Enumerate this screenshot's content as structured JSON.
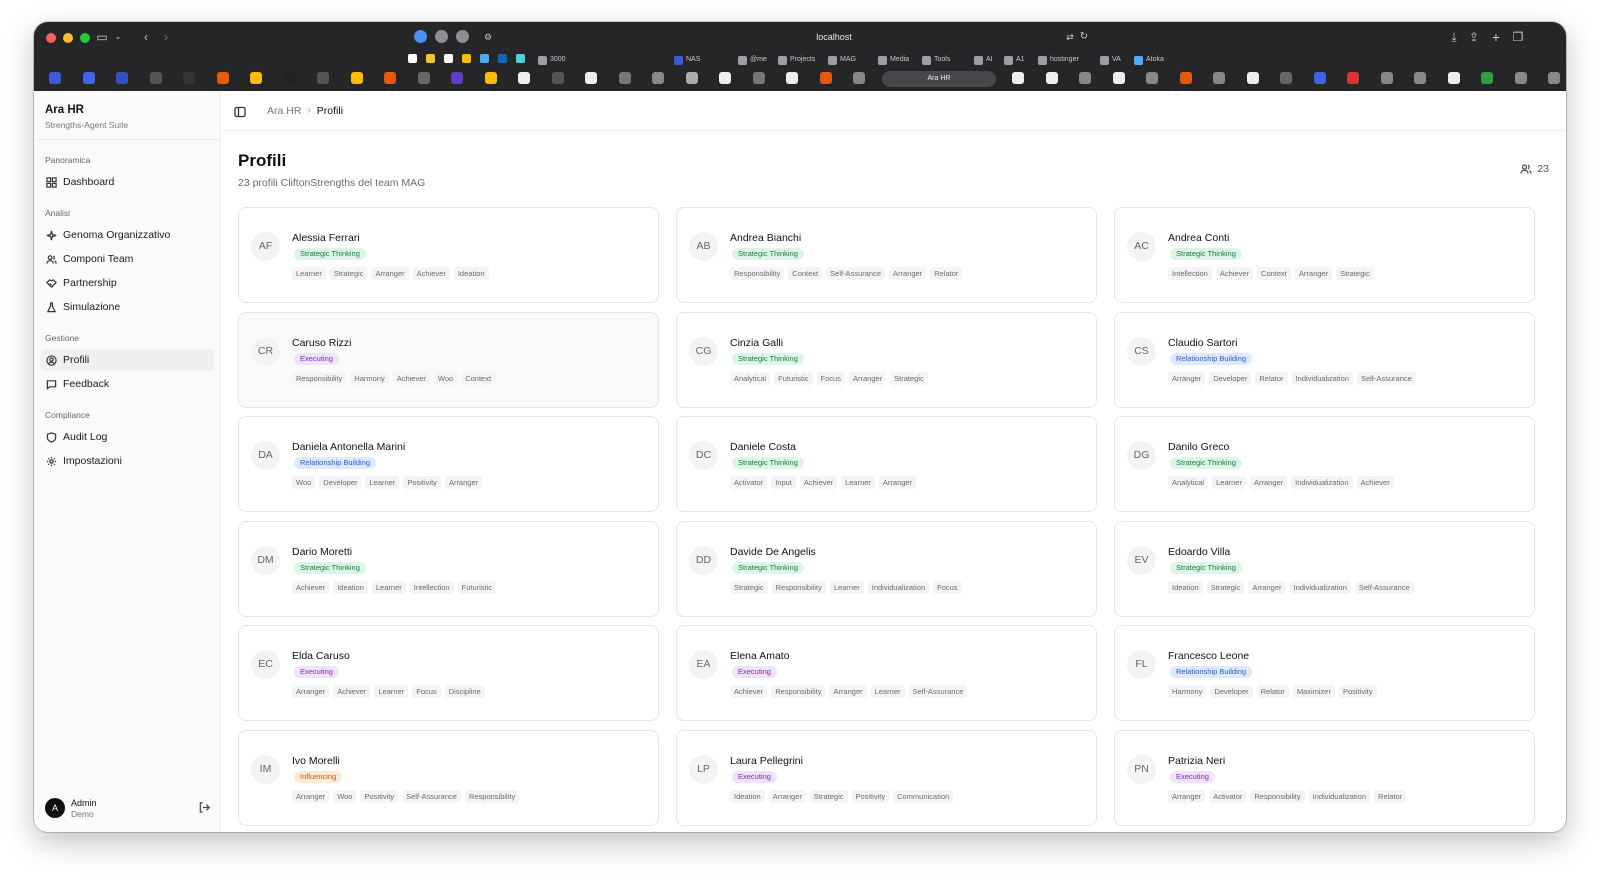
{
  "browser": {
    "url": "localhost",
    "active_tab_label": "Ara HR",
    "bookmarks": [
      {
        "label": "3000",
        "color": "#9aa0a6"
      },
      {
        "label": "NAS",
        "color": "#3b5bdb"
      },
      {
        "label": "@me",
        "color": "#9aa0a6"
      },
      {
        "label": "Projects",
        "color": "#9aa0a6"
      },
      {
        "label": "MAG",
        "color": "#9aa0a6"
      },
      {
        "label": "Media",
        "color": "#9aa0a6"
      },
      {
        "label": "Tools",
        "color": "#9aa0a6"
      },
      {
        "label": "AI",
        "color": "#9aa0a6"
      },
      {
        "label": "A1",
        "color": "#9aa0a6"
      },
      {
        "label": "hostinger",
        "color": "#9aa0a6"
      },
      {
        "label": "VA",
        "color": "#9aa0a6"
      },
      {
        "label": "Atoka",
        "color": "#4dabf7"
      }
    ]
  },
  "sidebar": {
    "brand_title": "Ara HR",
    "brand_subtitle": "Strengths-Agent Suite",
    "groups": [
      {
        "label": "Panoramica",
        "items": [
          {
            "label": "Dashboard",
            "icon": "grid-icon"
          }
        ]
      },
      {
        "label": "Analisi",
        "items": [
          {
            "label": "Genoma Organizzativo",
            "icon": "sparkle-icon"
          },
          {
            "label": "Componi Team",
            "icon": "users-icon"
          },
          {
            "label": "Partnership",
            "icon": "handshake-icon"
          },
          {
            "label": "Simulazione",
            "icon": "flask-icon"
          }
        ]
      },
      {
        "label": "Gestione",
        "items": [
          {
            "label": "Profili",
            "icon": "user-circle-icon"
          },
          {
            "label": "Feedback",
            "icon": "message-icon"
          }
        ]
      },
      {
        "label": "Compliance",
        "items": [
          {
            "label": "Audit Log",
            "icon": "shield-icon"
          },
          {
            "label": "Impostazioni",
            "icon": "gear-icon"
          }
        ]
      }
    ],
    "active_item": "Profili",
    "user": {
      "initial": "A",
      "name": "Admin",
      "role": "Demo"
    }
  },
  "header": {
    "breadcrumb": [
      "Ara HR",
      "Profili"
    ]
  },
  "page": {
    "title": "Profili",
    "subtitle": "23 profili CliftonStrengths del team MAG",
    "count": "23"
  },
  "theme_colors": {
    "Strategic Thinking": {
      "bg": "#dcf5e6",
      "fg": "#1a7a44"
    },
    "Executing": {
      "bg": "#efe2fb",
      "fg": "#7a2fb8"
    },
    "Relationship Building": {
      "bg": "#dde9ff",
      "fg": "#2e59c9"
    },
    "Influencing": {
      "bg": "#ffe8d4",
      "fg": "#c25b12"
    }
  },
  "profiles": [
    {
      "initials": "AF",
      "name": "Alessia Ferrari",
      "theme": "Strategic Thinking",
      "strengths": [
        "Learner",
        "Strategic",
        "Arranger",
        "Achiever",
        "Ideation"
      ]
    },
    {
      "initials": "AB",
      "name": "Andrea Bianchi",
      "theme": "Strategic Thinking",
      "strengths": [
        "Responsibility",
        "Context",
        "Self-Assurance",
        "Arranger",
        "Relator"
      ]
    },
    {
      "initials": "AC",
      "name": "Andrea Conti",
      "theme": "Strategic Thinking",
      "strengths": [
        "Intellection",
        "Achiever",
        "Context",
        "Arranger",
        "Strategic"
      ]
    },
    {
      "initials": "CR",
      "name": "Caruso Rizzi",
      "theme": "Executing",
      "strengths": [
        "Responsibility",
        "Harmony",
        "Achiever",
        "Woo",
        "Context"
      ]
    },
    {
      "initials": "CG",
      "name": "Cinzia Galli",
      "theme": "Strategic Thinking",
      "strengths": [
        "Analytical",
        "Futuristic",
        "Focus",
        "Arranger",
        "Strategic"
      ]
    },
    {
      "initials": "CS",
      "name": "Claudio Sartori",
      "theme": "Relationship Building",
      "strengths": [
        "Arranger",
        "Developer",
        "Relator",
        "Individualization",
        "Self-Assurance"
      ]
    },
    {
      "initials": "DA",
      "name": "Daniela Antonella Marini",
      "theme": "Relationship Building",
      "strengths": [
        "Woo",
        "Developer",
        "Learner",
        "Positivity",
        "Arranger"
      ]
    },
    {
      "initials": "DC",
      "name": "Daniele Costa",
      "theme": "Strategic Thinking",
      "strengths": [
        "Activator",
        "Input",
        "Achiever",
        "Learner",
        "Arranger"
      ]
    },
    {
      "initials": "DG",
      "name": "Danilo Greco",
      "theme": "Strategic Thinking",
      "strengths": [
        "Analytical",
        "Learner",
        "Arranger",
        "Individualization",
        "Achiever"
      ]
    },
    {
      "initials": "DM",
      "name": "Dario Moretti",
      "theme": "Strategic Thinking",
      "strengths": [
        "Achiever",
        "Ideation",
        "Learner",
        "Intellection",
        "Futuristic"
      ]
    },
    {
      "initials": "DD",
      "name": "Davide De Angelis",
      "theme": "Strategic Thinking",
      "strengths": [
        "Strategic",
        "Responsibility",
        "Learner",
        "Individualization",
        "Focus"
      ]
    },
    {
      "initials": "EV",
      "name": "Edoardo Villa",
      "theme": "Strategic Thinking",
      "strengths": [
        "Ideation",
        "Strategic",
        "Arranger",
        "Individualization",
        "Self-Assurance"
      ]
    },
    {
      "initials": "EC",
      "name": "Elda Caruso",
      "theme": "Executing",
      "strengths": [
        "Arranger",
        "Achiever",
        "Learner",
        "Focus",
        "Discipline"
      ]
    },
    {
      "initials": "EA",
      "name": "Elena Amato",
      "theme": "Executing",
      "strengths": [
        "Achiever",
        "Responsibility",
        "Arranger",
        "Learner",
        "Self-Assurance"
      ]
    },
    {
      "initials": "FL",
      "name": "Francesco Leone",
      "theme": "Relationship Building",
      "strengths": [
        "Harmony",
        "Developer",
        "Relator",
        "Maximizer",
        "Positivity"
      ]
    },
    {
      "initials": "IM",
      "name": "Ivo Morelli",
      "theme": "Influencing",
      "strengths": [
        "Arranger",
        "Woo",
        "Positivity",
        "Self-Assurance",
        "Responsibility"
      ]
    },
    {
      "initials": "LP",
      "name": "Laura Pellegrini",
      "theme": "Executing",
      "strengths": [
        "Ideation",
        "Arranger",
        "Strategic",
        "Positivity",
        "Communication"
      ]
    },
    {
      "initials": "PN",
      "name": "Patrizia Neri",
      "theme": "Executing",
      "strengths": [
        "Arranger",
        "Activator",
        "Responsibility",
        "Individualization",
        "Relator"
      ]
    }
  ]
}
